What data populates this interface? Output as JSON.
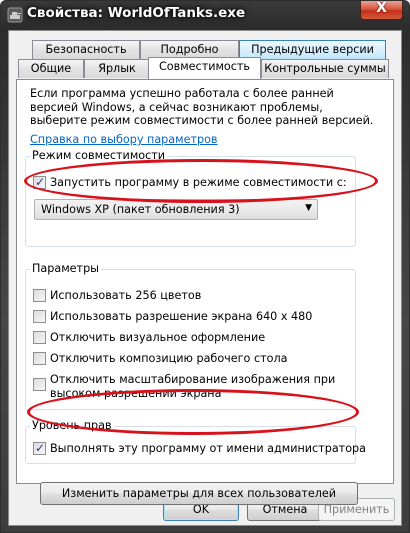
{
  "window": {
    "title": "Свойства: WorldOfTanks.exe",
    "close_glyph": "X"
  },
  "tabs": {
    "row1": [
      "Безопасность",
      "Подробно",
      "Предыдущие версии"
    ],
    "row2": [
      "Общие",
      "Ярлык",
      "Совместимость",
      "Контрольные суммы"
    ],
    "active": "Совместимость"
  },
  "compat": {
    "description": "Если программа успешно работала с более ранней версией Windows, а сейчас возникают проблемы, выберите режим совместимости с более ранней версией.",
    "help_link": "Справка по выбору параметров",
    "mode_group": {
      "legend": "Режим совместимости",
      "checkbox_label": "Запустить программу в режиме совместимости с:",
      "checked": true,
      "selected_os": "Windows XP (пакет обновления 3)"
    },
    "params_group": {
      "legend": "Параметры",
      "items": [
        {
          "label": "Использовать 256 цветов",
          "checked": false
        },
        {
          "label": "Использовать разрешение экрана 640 x 480",
          "checked": false
        },
        {
          "label": "Отключить визуальное оформление",
          "checked": false
        },
        {
          "label": "Отключить композицию рабочего стола",
          "checked": false
        },
        {
          "label": "Отключить масштабирование изображения при",
          "label2": "высоком разрешении экрана",
          "checked": false
        }
      ]
    },
    "privilege_group": {
      "legend": "Уровень прав",
      "checkbox_label": "Выполнять эту программу от имени администратора",
      "checked": true
    },
    "all_users_button": "Изменить параметры для всех пользователей"
  },
  "footer": {
    "ok": "OK",
    "cancel": "Отмена",
    "apply": "Применить"
  },
  "colors": {
    "annotation_ellipse": "#d8121b",
    "link": "#0066cc"
  }
}
